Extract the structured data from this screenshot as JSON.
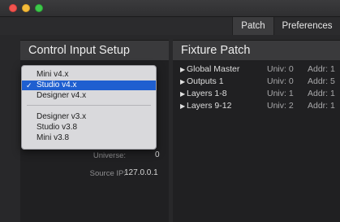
{
  "tabs": {
    "patch": "Patch",
    "preferences": "Preferences"
  },
  "left_panel": {
    "title": "Control Input Setup",
    "universe_label": "Universe:",
    "universe_value": "0",
    "source_ip_label": "Source IP:",
    "source_ip_value": "127.0.0.1"
  },
  "dropdown": {
    "selected": "Studio v4.x",
    "options": [
      "Mini v4.x",
      "Studio v4.x",
      "Designer v4.x",
      "Designer v3.x",
      "Studio v3.8",
      "Mini v3.8"
    ]
  },
  "right_panel": {
    "title": "Fixture Patch",
    "rows": [
      {
        "name": "Global Master",
        "univ": "Univ: 0",
        "addr": "Addr: 1"
      },
      {
        "name": "Outputs 1",
        "univ": "Univ: 0",
        "addr": "Addr: 5"
      },
      {
        "name": "Layers 1-8",
        "univ": "Univ: 1",
        "addr": "Addr: 1"
      },
      {
        "name": "Layers 9-12",
        "univ": "Univ: 2",
        "addr": "Addr: 1"
      }
    ]
  },
  "colors": {
    "background": "#28282a",
    "panel_header": "#3a3a3c",
    "selection": "#1f5fd0",
    "close": "#f2544f",
    "minimize": "#f5bd3b",
    "zoom": "#3ec84b"
  }
}
